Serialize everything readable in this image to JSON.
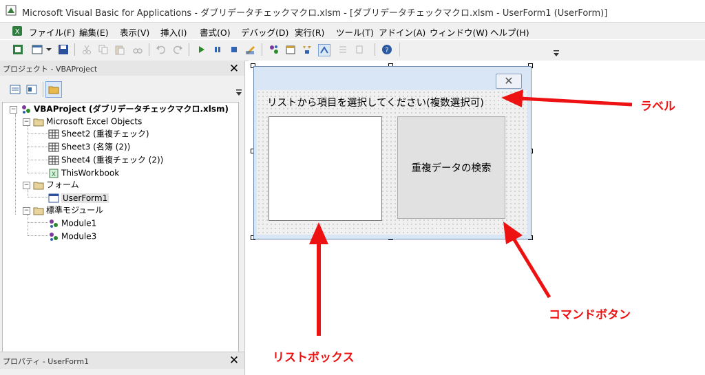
{
  "window": {
    "title": "Microsoft Visual Basic for Applications - ダブリデータチェックマクロ.xlsm - [ダブリデータチェックマクロ.xlsm - UserForm1 (UserForm)]"
  },
  "menu": [
    "ファイル(F)",
    "編集(E)",
    "表示(V)",
    "挿入(I)",
    "書式(O)",
    "デバッグ(D)",
    "実行(R)",
    "ツール(T)",
    "アドイン(A)",
    "ウィンドウ(W)",
    "ヘルプ(H)"
  ],
  "project_panel": {
    "title": "プロジェクト - VBAProject",
    "tree": {
      "root": "VBAProject (ダブリデータチェックマクロ.xlsm)",
      "excel_objects_folder": "Microsoft Excel Objects",
      "excel_objects": [
        "Sheet2 (重複チェック)",
        "Sheet3 (名簿 (2))",
        "Sheet4 (重複チェック (2))",
        "ThisWorkbook"
      ],
      "forms_folder": "フォーム",
      "forms": [
        "UserForm1"
      ],
      "modules_folder": "標準モジュール",
      "modules": [
        "Module1",
        "Module3"
      ]
    }
  },
  "properties_panel": {
    "title": "プロパティ - UserForm1"
  },
  "userform": {
    "close_glyph": "✕",
    "label_caption": "リストから項目を選択してください(複数選択可)",
    "command_button_caption": "重複データの検索"
  },
  "annotations": {
    "label": "ラベル",
    "command_button": "コマンドボタン",
    "list_box": "リストボックス",
    "color": "#ee1111"
  }
}
